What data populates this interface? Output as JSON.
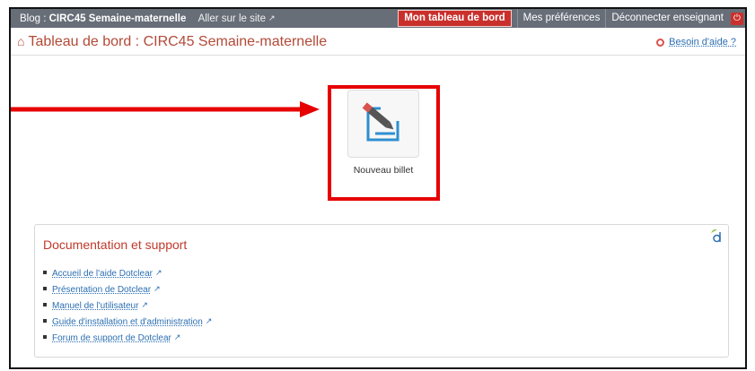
{
  "topbar": {
    "blog_prefix": "Blog : ",
    "blog_name": "CIRC45 Semaine-maternelle",
    "visit_site": "Aller sur le site",
    "dashboard": "Mon tableau de bord",
    "preferences": "Mes préférences",
    "logout": "Déconnecter enseignant"
  },
  "header": {
    "title": "Tableau de bord : CIRC45 Semaine-maternelle",
    "help": "Besoin d'aide ?"
  },
  "quick_actions": {
    "new_entry_label": "Nouveau billet"
  },
  "documentation": {
    "title": "Documentation et support",
    "links": [
      "Accueil de l'aide Dotclear",
      "Présentation de Dotclear",
      "Manuel de l'utilisateur",
      "Guide d'installation et d'administration",
      "Forum de support de Dotclear"
    ]
  },
  "colors": {
    "topbar": "#676e78",
    "accent_red": "#c9302c",
    "link_blue": "#2c6fb2",
    "annotation_red": "#e60000"
  },
  "icons": [
    "home-icon",
    "external-link-icon",
    "power-icon",
    "lifebuoy-icon",
    "pen-edit-icon",
    "dotclear-logo-icon"
  ]
}
